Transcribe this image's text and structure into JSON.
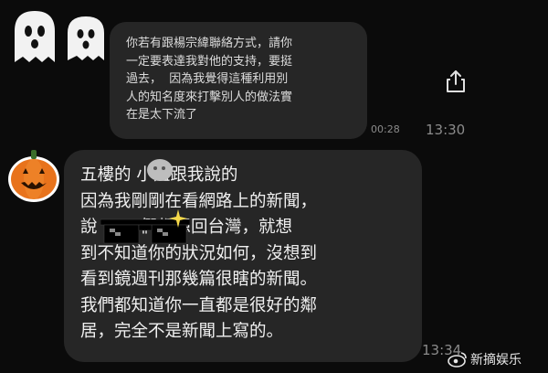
{
  "messages": [
    {
      "side": "outgoing",
      "text": "你若有跟楊宗緯聯絡方式，請你\n一定要表達我對他的支持，要挺\n過去，  因為我覺得這種利用別\n人的知名度來打擊別人的做法實\n在是太下流了",
      "duration": "00:28",
      "time": "13:30"
    },
    {
      "side": "incoming",
      "text": "五樓的 小姐跟我說的\n因為我剛剛在看網路上的新聞，\n說        們都想回台灣，就想\n到不知道你的狀況如何，沒想到\n看到鏡週刊那幾篇很瞎的新聞。\n我們都知道你一直都是很好的鄰\n居，完全不是新聞上寫的。",
      "time": "13:34"
    }
  ],
  "icons": {
    "outgoing_avatar": "ghosts-icon",
    "incoming_avatar": "pumpkin-icon",
    "share": "share-icon",
    "redaction": "pixel-sunglasses-icon"
  },
  "watermark": {
    "text": "新摘娱乐",
    "logo": "weibo-logo-icon"
  },
  "colors": {
    "background": "#0b0b0b",
    "bubble": "#262626",
    "timestamp": "#8b8b8b",
    "pumpkin": "#e8731c"
  }
}
